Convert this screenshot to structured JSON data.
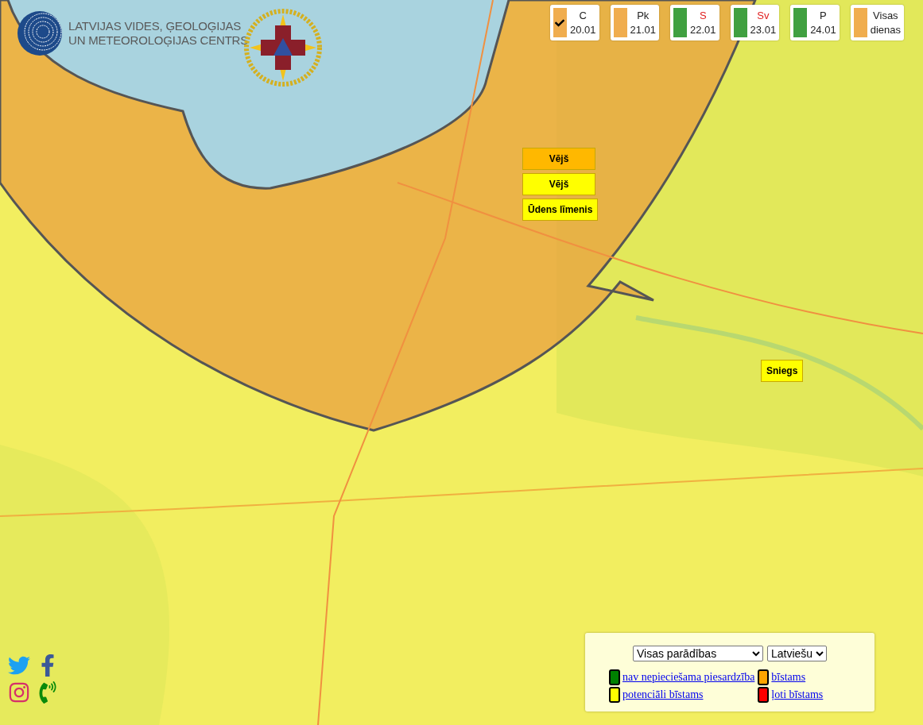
{
  "header": {
    "logo_text": [
      "LATVIJAS VIDES, ĢEOLOĢIJAS",
      "UN METEOROLOĢIJAS CENTRS"
    ]
  },
  "days": [
    {
      "kind": "day",
      "day": "C",
      "date": "20.01",
      "color": "#f0ad4e",
      "weekend": false,
      "selected": true
    },
    {
      "kind": "day",
      "day": "Pk",
      "date": "21.01",
      "color": "#f0ad4e",
      "weekend": false,
      "selected": false
    },
    {
      "kind": "day",
      "day": "S",
      "date": "22.01",
      "color": "#40a040",
      "weekend": true,
      "selected": false
    },
    {
      "kind": "day",
      "day": "Sv",
      "date": "23.01",
      "color": "#40a040",
      "weekend": true,
      "selected": false
    },
    {
      "kind": "day",
      "day": "P",
      "date": "24.01",
      "color": "#40a040",
      "weekend": false,
      "selected": false
    },
    {
      "kind": "all",
      "label": "Visas dienas",
      "color": "#f0ad4e",
      "selected": false
    }
  ],
  "map_warnings": [
    {
      "label": "Vējš",
      "color": "#ffb800"
    },
    {
      "label": "Vējš",
      "color": "#ffff00"
    },
    {
      "label": "Ūdens līmenis",
      "color": "#ffff00"
    },
    {
      "label": "Sniegs",
      "color": "#ffff00"
    }
  ],
  "legend": {
    "phenomenon_select": "Visas parādības",
    "language_select": "Latviešu",
    "items": [
      {
        "label": "nav nepieciešama piesardzība",
        "color": "#008000"
      },
      {
        "label": "bīstams",
        "color": "#ffa500"
      },
      {
        "label": "potenciāli bīstams",
        "color": "#ffff00"
      },
      {
        "label": "ļoti bīstams",
        "color": "#ff0000"
      }
    ]
  }
}
